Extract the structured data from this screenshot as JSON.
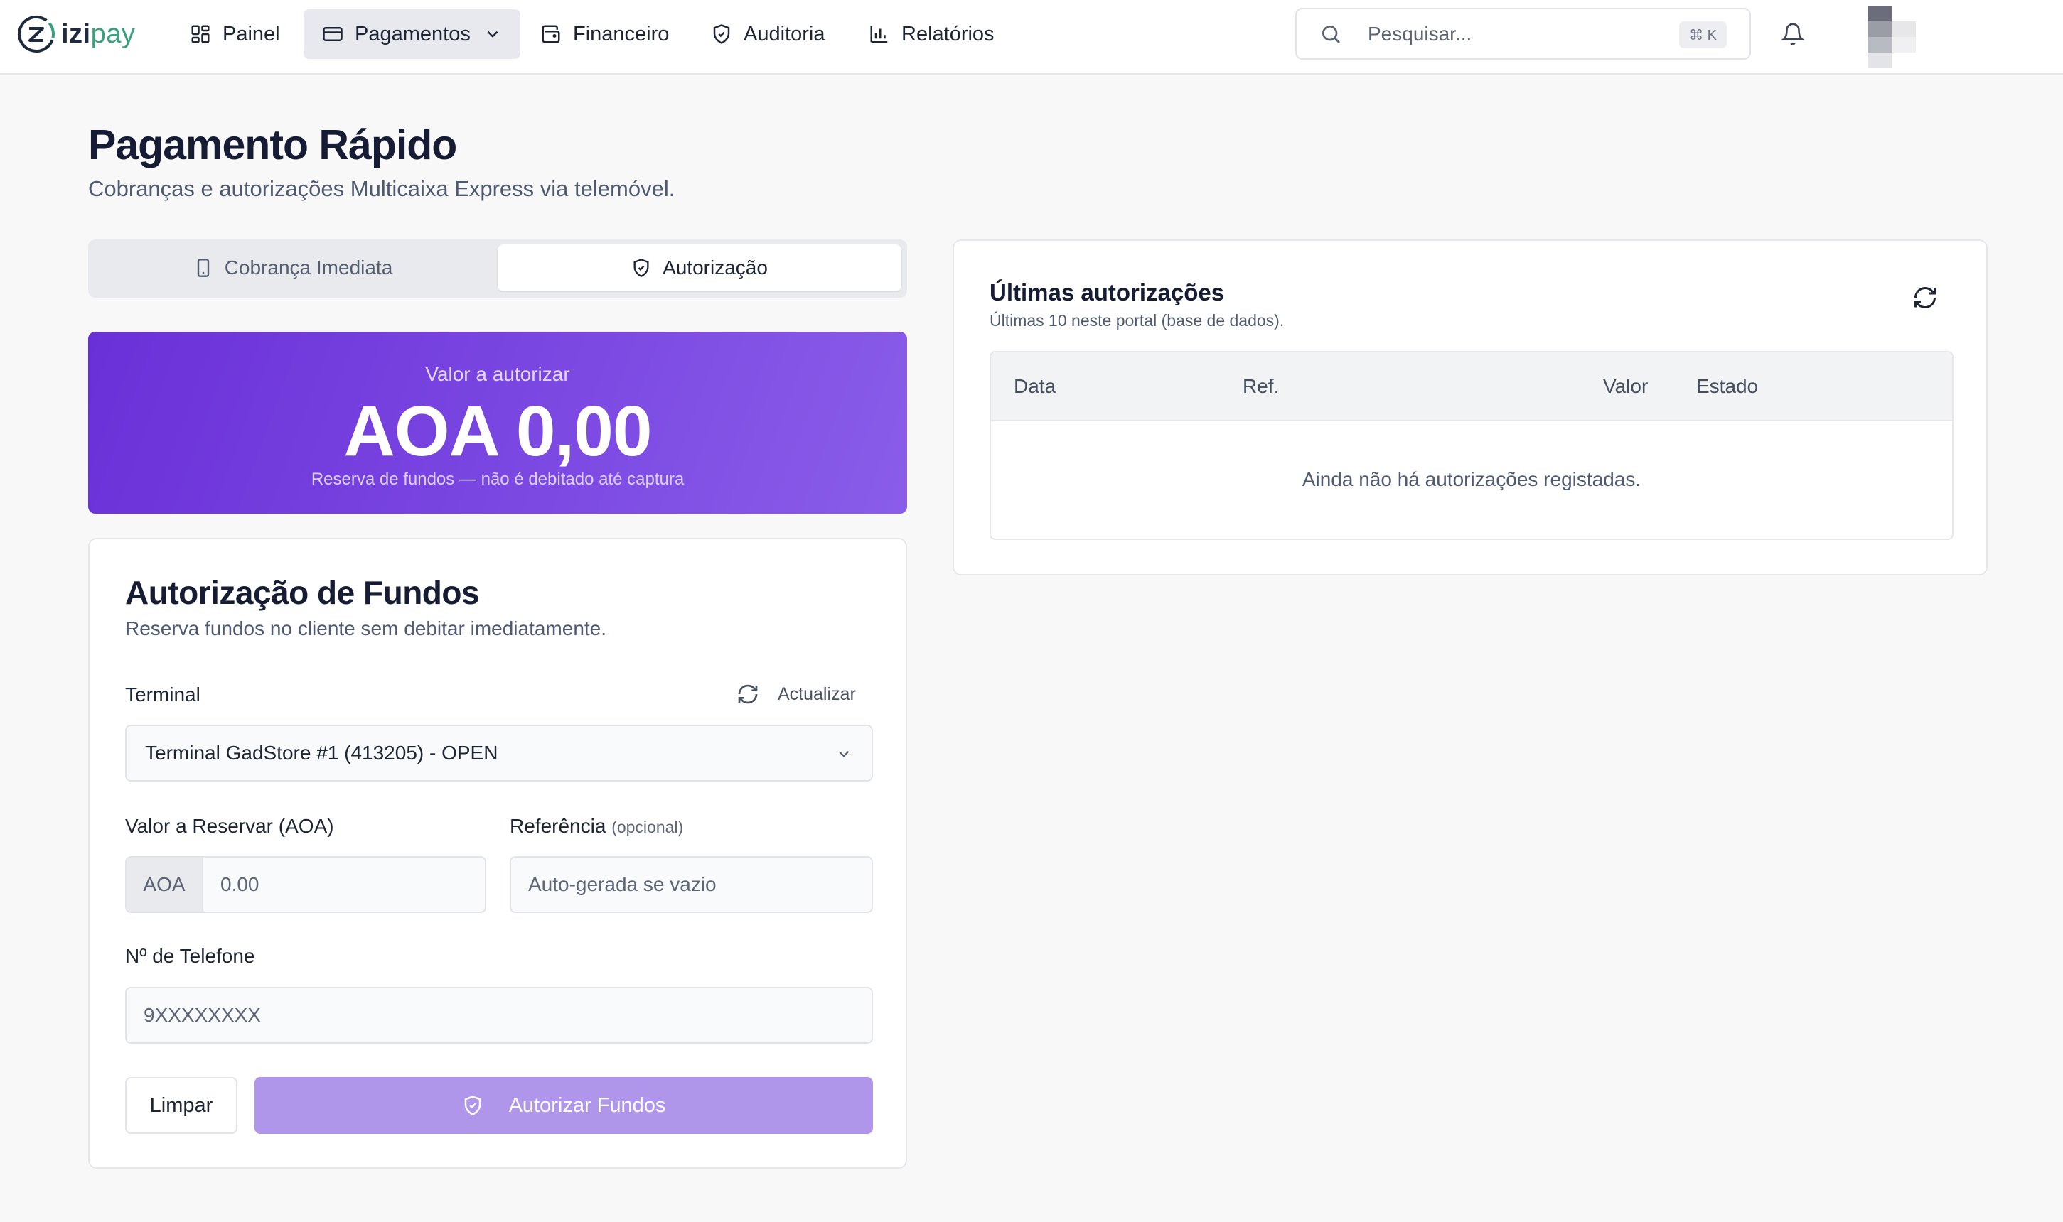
{
  "brand": {
    "name_part1": "izi",
    "name_part2": "pay",
    "accent": "#3aa17e"
  },
  "nav": {
    "items": [
      {
        "label": "Painel",
        "icon": "dashboard-icon"
      },
      {
        "label": "Pagamentos",
        "icon": "credit-card-icon",
        "active": true
      },
      {
        "label": "Financeiro",
        "icon": "wallet-icon"
      },
      {
        "label": "Auditoria",
        "icon": "shield-icon"
      },
      {
        "label": "Relatórios",
        "icon": "bar-chart-icon"
      }
    ],
    "search": {
      "placeholder": "Pesquisar...",
      "shortcut": "⌘ K"
    }
  },
  "page": {
    "title": "Pagamento Rápido",
    "subtitle": "Cobranças e autorizações Multicaixa Express via telemóvel."
  },
  "tabs": [
    {
      "label": "Cobrança Imediata",
      "icon": "phone-icon",
      "selected": false
    },
    {
      "label": "Autorização",
      "icon": "shield-check-icon",
      "selected": true
    }
  ],
  "hero": {
    "label": "Valor a autorizar",
    "amount": "AOA 0,00",
    "note": "Reserva de fundos — não é debitado até captura",
    "gradient_start": "#6a30d8",
    "gradient_end": "#8a5de9"
  },
  "form": {
    "title": "Autorização de Fundos",
    "subtitle": "Reserva fundos no cliente sem debitar imediatamente.",
    "terminal": {
      "label": "Terminal",
      "refresh_label": "Actualizar",
      "selected_value": "Terminal GadStore #1 (413205) - OPEN"
    },
    "amount": {
      "label": "Valor a Reservar (AOA)",
      "currency_prefix": "AOA",
      "placeholder": "0.00",
      "value": ""
    },
    "reference": {
      "label": "Referência",
      "optional_hint": "(opcional)",
      "placeholder": "Auto-gerada se vazio",
      "value": ""
    },
    "phone": {
      "label": "Nº de Telefone",
      "placeholder": "9XXXXXXXX",
      "value": ""
    },
    "clear_label": "Limpar",
    "submit_label": "Autorizar Fundos",
    "submit_color": "#b096ea"
  },
  "recent": {
    "title": "Últimas autorizações",
    "subtitle": "Últimas 10 neste portal (base de dados).",
    "columns": [
      "Data",
      "Ref.",
      "Valor",
      "Estado"
    ],
    "rows": [],
    "empty_message": "Ainda não há autorizações registadas."
  }
}
